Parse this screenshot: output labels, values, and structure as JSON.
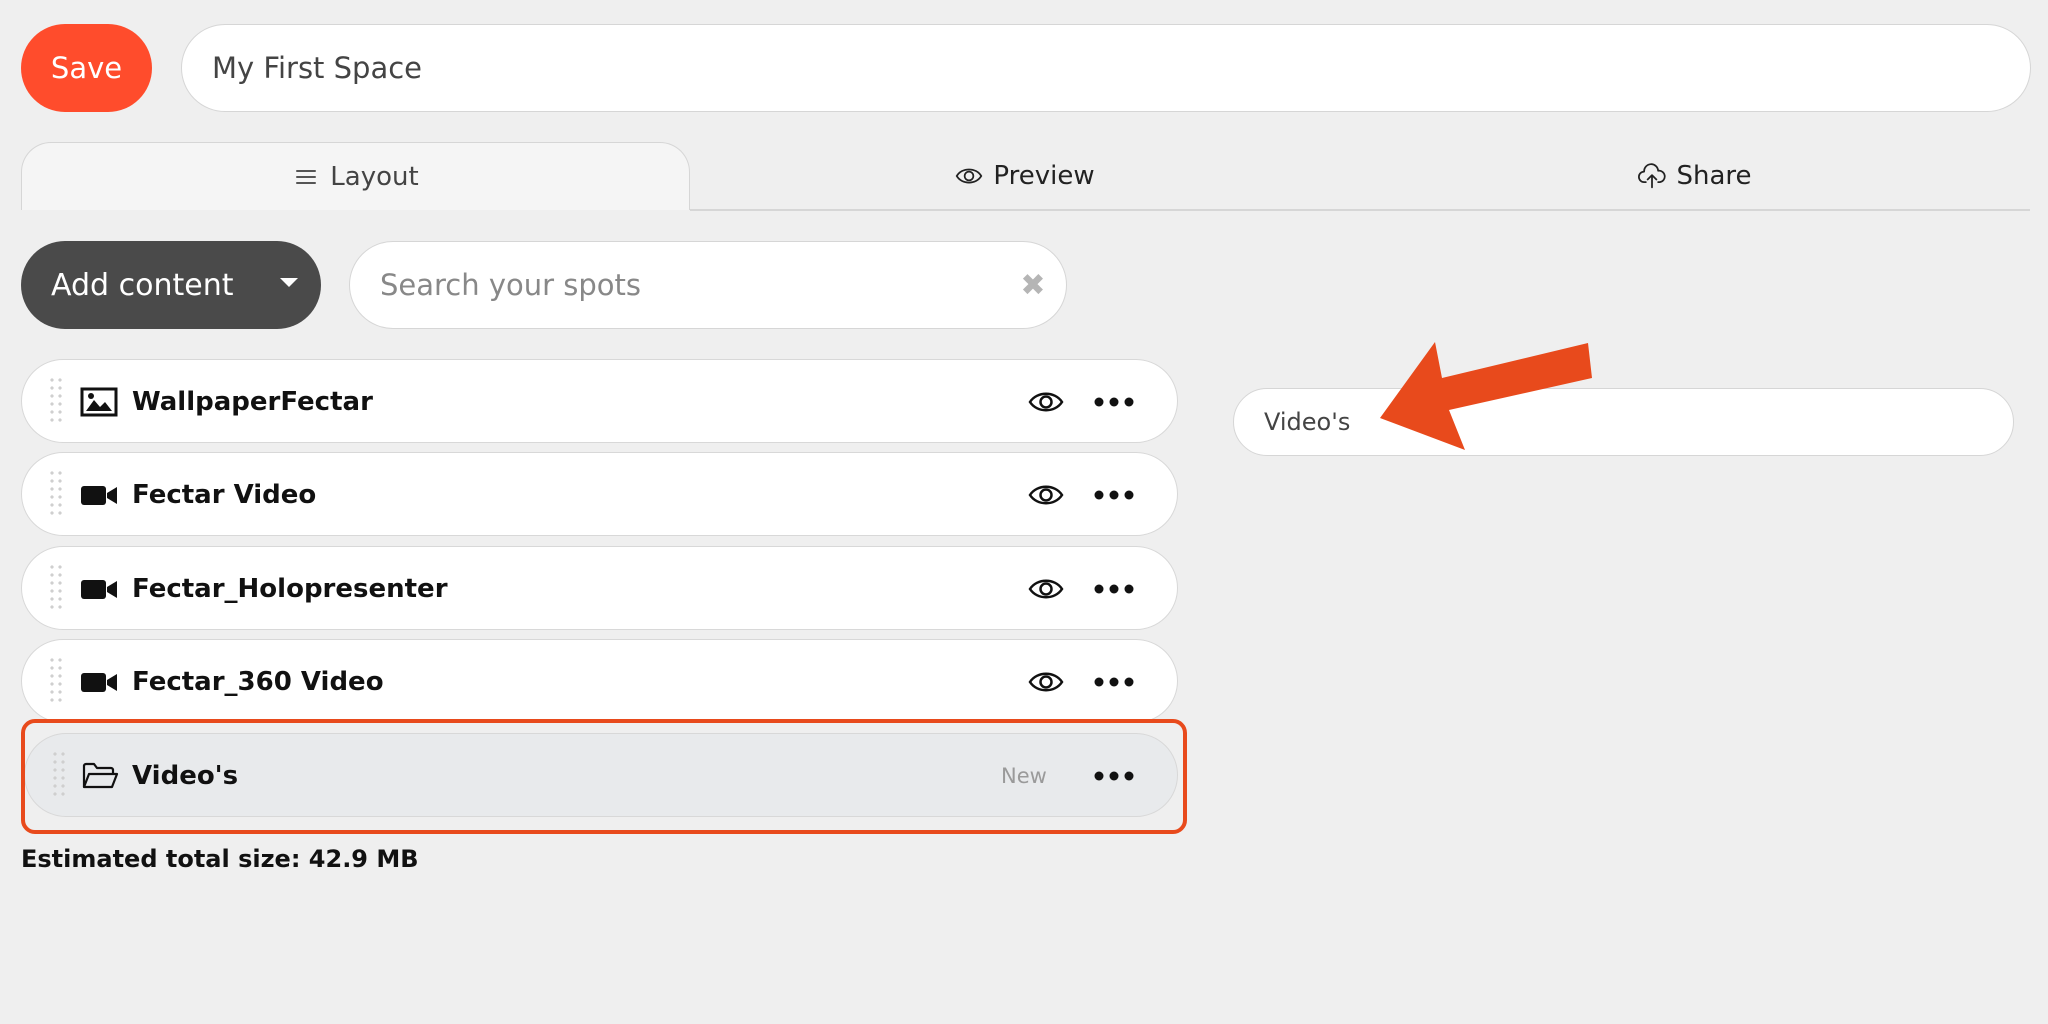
{
  "header": {
    "save_label": "Save",
    "space_name": "My First Space"
  },
  "tabs": [
    {
      "label": "Layout",
      "icon": "menu-icon",
      "active": true
    },
    {
      "label": "Preview",
      "icon": "eye-icon",
      "active": false
    },
    {
      "label": "Share",
      "icon": "cloud-upload-icon",
      "active": false
    }
  ],
  "toolbar": {
    "add_content_label": "Add content",
    "search_placeholder": "Search your spots",
    "clear_glyph": "✖"
  },
  "items": [
    {
      "label": "WallpaperFectar",
      "icon": "image-icon"
    },
    {
      "label": "Fectar Video",
      "icon": "video-camera-icon"
    },
    {
      "label": "Fectar_Holopresenter",
      "icon": "video-camera-icon"
    },
    {
      "label": "Fectar_360 Video",
      "icon": "video-camera-icon"
    },
    {
      "label": "Video's",
      "icon": "folder-icon",
      "badge": "New",
      "highlighted": true
    }
  ],
  "footer": {
    "total_size": "Estimated total size: 42.9 MB"
  },
  "folder_editor": {
    "name_value": "Video's"
  },
  "colors": {
    "accent": "#ff4c2c",
    "dark_button": "#4a4a4a",
    "highlight": "#e84a1c",
    "background": "#efefef"
  }
}
